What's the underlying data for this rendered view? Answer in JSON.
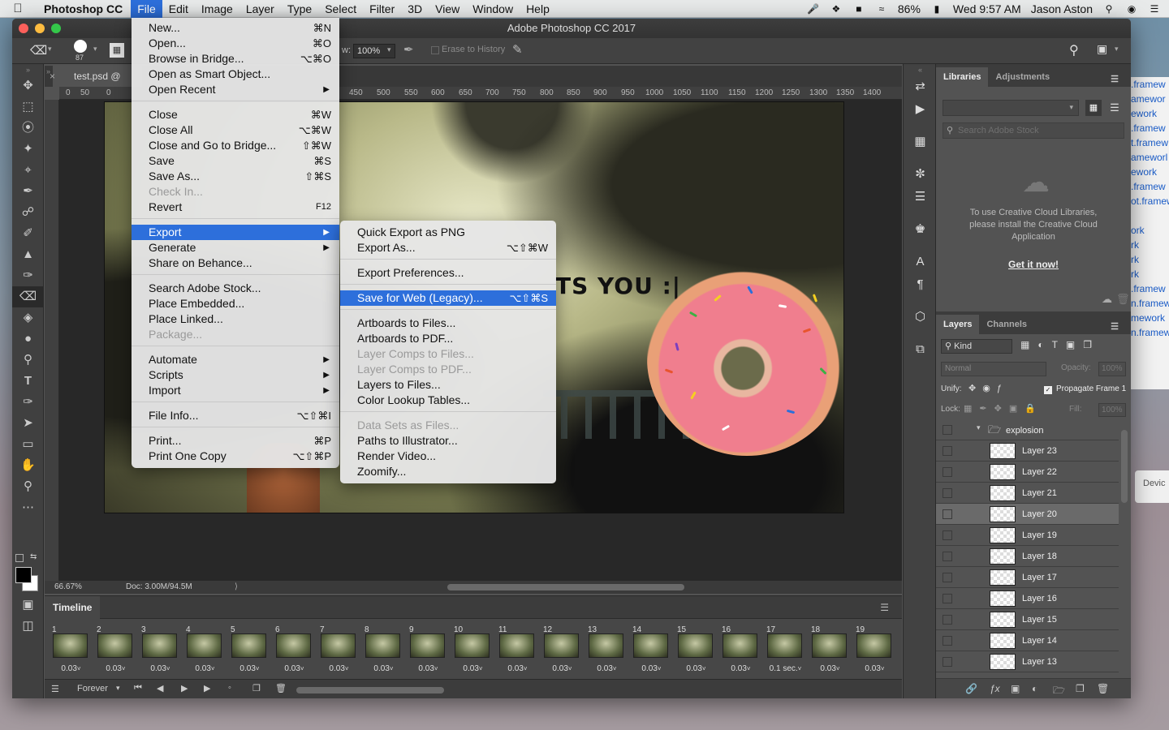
{
  "menubar": {
    "app": "Photoshop CC",
    "items": [
      "File",
      "Edit",
      "Image",
      "Layer",
      "Type",
      "Select",
      "Filter",
      "3D",
      "View",
      "Window",
      "Help"
    ],
    "battery": "86%",
    "clock": "Wed 9:57 AM",
    "user": "Jason Aston"
  },
  "window": {
    "title": "Adobe Photoshop CC 2017"
  },
  "options": {
    "brush_size": "87",
    "zoom_pct": "100%",
    "flow_prefix": "w:",
    "erase_history": "Erase to History"
  },
  "doc": {
    "tab": "test.psd @ 66.7",
    "caption": "TS YOU :|",
    "zoom": "66.67%",
    "docinfo": "Doc: 3.00M/94.5M"
  },
  "ruler": {
    "h": [
      "0",
      "50",
      "0",
      "450",
      "500",
      "550",
      "600",
      "650",
      "700",
      "750",
      "800",
      "850",
      "900",
      "950",
      "1000",
      "1050",
      "1100",
      "1150",
      "1200",
      "1250",
      "1300",
      "1350",
      "1400"
    ]
  },
  "file_menu": [
    {
      "label": "New...",
      "sc": "⌘N"
    },
    {
      "label": "Open...",
      "sc": "⌘O"
    },
    {
      "label": "Browse in Bridge...",
      "sc": "⌥⌘O"
    },
    {
      "label": "Open as Smart Object...",
      "sc": ""
    },
    {
      "label": "Open Recent",
      "sc": "▶"
    },
    {
      "label": "Close",
      "sc": "⌘W"
    },
    {
      "label": "Close All",
      "sc": "⌥⌘W"
    },
    {
      "label": "Close and Go to Bridge...",
      "sc": "⇧⌘W"
    },
    {
      "label": "Save",
      "sc": "⌘S"
    },
    {
      "label": "Save As...",
      "sc": "⇧⌘S"
    },
    {
      "label": "Check In...",
      "sc": ""
    },
    {
      "label": "Revert",
      "sc": "F12"
    },
    {
      "label": "Export",
      "sc": "▶"
    },
    {
      "label": "Generate",
      "sc": "▶"
    },
    {
      "label": "Share on Behance...",
      "sc": ""
    },
    {
      "label": "Search Adobe Stock...",
      "sc": ""
    },
    {
      "label": "Place Embedded...",
      "sc": ""
    },
    {
      "label": "Place Linked...",
      "sc": ""
    },
    {
      "label": "Package...",
      "sc": ""
    },
    {
      "label": "Automate",
      "sc": "▶"
    },
    {
      "label": "Scripts",
      "sc": "▶"
    },
    {
      "label": "Import",
      "sc": "▶"
    },
    {
      "label": "File Info...",
      "sc": "⌥⇧⌘I"
    },
    {
      "label": "Print...",
      "sc": "⌘P"
    },
    {
      "label": "Print One Copy",
      "sc": "⌥⇧⌘P"
    }
  ],
  "export_menu": [
    {
      "label": "Quick Export as PNG",
      "sc": ""
    },
    {
      "label": "Export As...",
      "sc": "⌥⇧⌘W"
    },
    {
      "label": "Export Preferences...",
      "sc": ""
    },
    {
      "label": "Save for Web (Legacy)...",
      "sc": "⌥⇧⌘S"
    },
    {
      "label": "Artboards to Files...",
      "sc": ""
    },
    {
      "label": "Artboards to PDF...",
      "sc": ""
    },
    {
      "label": "Layer Comps to Files...",
      "sc": ""
    },
    {
      "label": "Layer Comps to PDF...",
      "sc": ""
    },
    {
      "label": "Layers to Files...",
      "sc": ""
    },
    {
      "label": "Color Lookup Tables...",
      "sc": ""
    },
    {
      "label": "Data Sets as Files...",
      "sc": ""
    },
    {
      "label": "Paths to Illustrator...",
      "sc": ""
    },
    {
      "label": "Render Video...",
      "sc": ""
    },
    {
      "label": "Zoomify...",
      "sc": ""
    }
  ],
  "timeline": {
    "title": "Timeline",
    "loop": "Forever",
    "frames": [
      {
        "n": "1",
        "d": "0.03"
      },
      {
        "n": "2",
        "d": "0.03"
      },
      {
        "n": "3",
        "d": "0.03"
      },
      {
        "n": "4",
        "d": "0.03"
      },
      {
        "n": "5",
        "d": "0.03"
      },
      {
        "n": "6",
        "d": "0.03"
      },
      {
        "n": "7",
        "d": "0.03"
      },
      {
        "n": "8",
        "d": "0.03"
      },
      {
        "n": "9",
        "d": "0.03"
      },
      {
        "n": "10",
        "d": "0.03"
      },
      {
        "n": "11",
        "d": "0.03"
      },
      {
        "n": "12",
        "d": "0.03"
      },
      {
        "n": "13",
        "d": "0.03"
      },
      {
        "n": "14",
        "d": "0.03"
      },
      {
        "n": "15",
        "d": "0.03"
      },
      {
        "n": "16",
        "d": "0.03"
      },
      {
        "n": "17",
        "d": "0.1 sec."
      },
      {
        "n": "18",
        "d": "0.03"
      },
      {
        "n": "19",
        "d": "0.03"
      }
    ]
  },
  "libraries": {
    "tab1": "Libraries",
    "tab2": "Adjustments",
    "search": "Search Adobe Stock",
    "msg": "To use Creative Cloud Libraries, please install the Creative Cloud Application",
    "link": "Get it now!"
  },
  "layers": {
    "tab1": "Layers",
    "tab2": "Channels",
    "kind": "Kind",
    "blend": "Normal",
    "opacity_label": "Opacity:",
    "opacity": "100%",
    "unify": "Unify:",
    "propagate": "Propagate Frame 1",
    "lock": "Lock:",
    "fill_label": "Fill:",
    "fill": "100%",
    "group": "explosion",
    "items": [
      "Layer 23",
      "Layer 22",
      "Layer 21",
      "Layer 20",
      "Layer 19",
      "Layer 18",
      "Layer 17",
      "Layer 16",
      "Layer 15",
      "Layer 14",
      "Layer 13"
    ],
    "selected": "Layer 20"
  },
  "background_window": {
    "lines": [
      ".framew",
      "amewor",
      "ework",
      ".framew",
      "t.framew",
      "ameworl",
      "ework",
      ".framew",
      "ot.framew",
      "",
      "ork",
      "rk",
      "rk",
      "rk",
      ".framew",
      "n.framew",
      "mework",
      "n.framew"
    ],
    "device": "Devic"
  }
}
